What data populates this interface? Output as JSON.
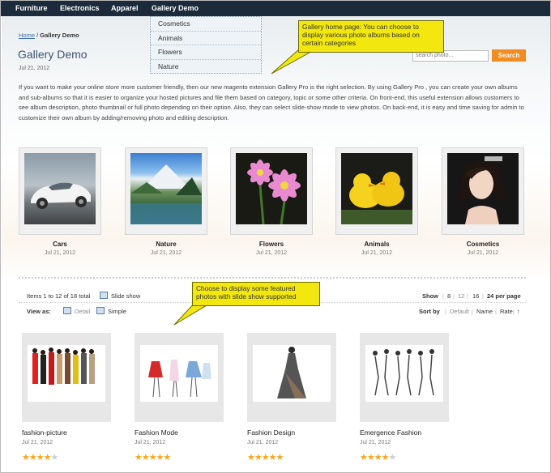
{
  "nav": {
    "items": [
      "Furniture",
      "Electronics",
      "Apparel",
      "Gallery Demo"
    ],
    "dropdown": [
      "Cosmetics",
      "Animals",
      "Flowers",
      "Nature"
    ]
  },
  "breadcrumb": {
    "home": "Home",
    "separator": " / ",
    "current": "Gallery Demo"
  },
  "page": {
    "title": "Gallery Demo",
    "date": "Jul 21, 2012",
    "description": "If you want to make your online store more customer friendly, then our new magento extension Gallery Pro is the right selection. By using Gallery Pro , you can create your own albums and sub-albums so that it is easier to organize your hosted pictures and file them based on category, topic or some other criteria. On front-end, this useful extension allows customers to see album description, photo thumbnail or full photo depending on their option. Also, they can select slide-show mode to view photos. On back-end, it is easy and time saving for admin to customize their own album by adding/removing photo and editing description."
  },
  "search": {
    "placeholder": "search photo...",
    "button": "Search"
  },
  "callouts": {
    "top": "Gallery home page: You can choose to display various photo albums based on certain categories",
    "bottom": "Choose to display some featured photos with slide show supported"
  },
  "albums": [
    {
      "label": "Cars",
      "date": "Jul 21, 2012"
    },
    {
      "label": "Nature",
      "date": "Jul 21, 2012"
    },
    {
      "label": "Flowers",
      "date": "Jul 21, 2012"
    },
    {
      "label": "Animals",
      "date": "Jul 21, 2012"
    },
    {
      "label": "Cosmetics",
      "date": "Jul 21, 2012"
    }
  ],
  "toolbar": {
    "items_text": "Items 1 to 12 of 18 total",
    "slideshow": "Slide show",
    "view_as": "View as:",
    "detail": "Detail",
    "simple": "Simple",
    "show_label": "Show",
    "show_opts": [
      "8",
      "12",
      "16",
      "24 per page"
    ],
    "sort_label": "Sort by",
    "sort_opts": [
      "Default",
      "Name",
      "Rate"
    ],
    "sort_dir": "↑"
  },
  "products": [
    {
      "name": "fashion-picture",
      "date": "Jul 21, 2012",
      "rating": 4
    },
    {
      "name": "Fashion Mode",
      "date": "Jul 21, 2012",
      "rating": 5
    },
    {
      "name": "Fashion Design",
      "date": "Jul 21, 2012",
      "rating": 5
    },
    {
      "name": "Emergence Fashion",
      "date": "Jul 21, 2012",
      "rating": 4
    }
  ],
  "colors": {
    "nav_bg": "#1c2b3b",
    "accent": "#f18c22",
    "callout": "#f2e70f",
    "link": "#3a6fb0"
  }
}
